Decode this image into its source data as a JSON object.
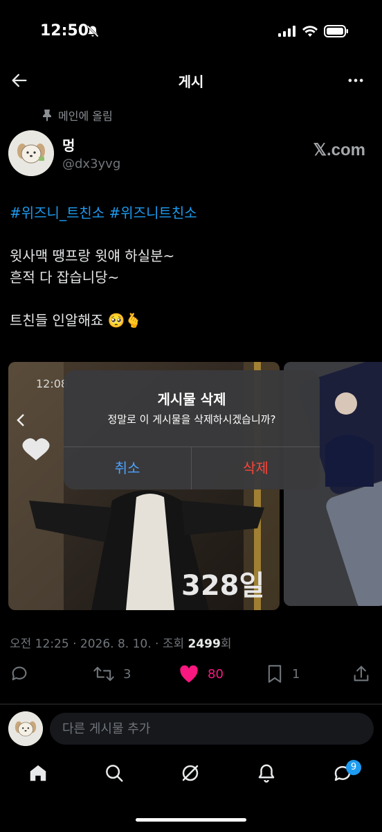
{
  "status_bar": {
    "time": "12:50"
  },
  "header": {
    "title": "게시"
  },
  "post": {
    "pinned_label": "메인에 올림",
    "author_name": "멍",
    "author_handle": "@dx3yvg",
    "source_badge": "𝕏.com",
    "hashtags": "#위즈니_트친소 #위즈니트친소",
    "line1": "윗사맥 땡프랑 윗얘 하실분~",
    "line2": "흔적 다 잡습니당~",
    "line3": "트친들 인알해죠 🥺🫰",
    "media_overlay_time": "12:08",
    "media_day_label": "328일"
  },
  "dialog": {
    "title": "게시물 삭제",
    "message": "정말로 이 게시물을 삭제하시겠습니까?",
    "cancel_label": "취소",
    "delete_label": "삭제"
  },
  "meta": {
    "prefix": "오전 12:25 · 2026. 8. 10. · 조회 ",
    "views": "2499",
    "suffix": "회"
  },
  "actions": {
    "retweets": "3",
    "likes": "80",
    "bookmarks": "1"
  },
  "reply": {
    "placeholder": "다른 게시물 추가"
  },
  "tabs": {
    "messages_badge": "9"
  },
  "colors": {
    "accent": "#1d9bf0",
    "like": "#f91880",
    "delete": "#ff453a",
    "cancel": "#4da3ff"
  }
}
